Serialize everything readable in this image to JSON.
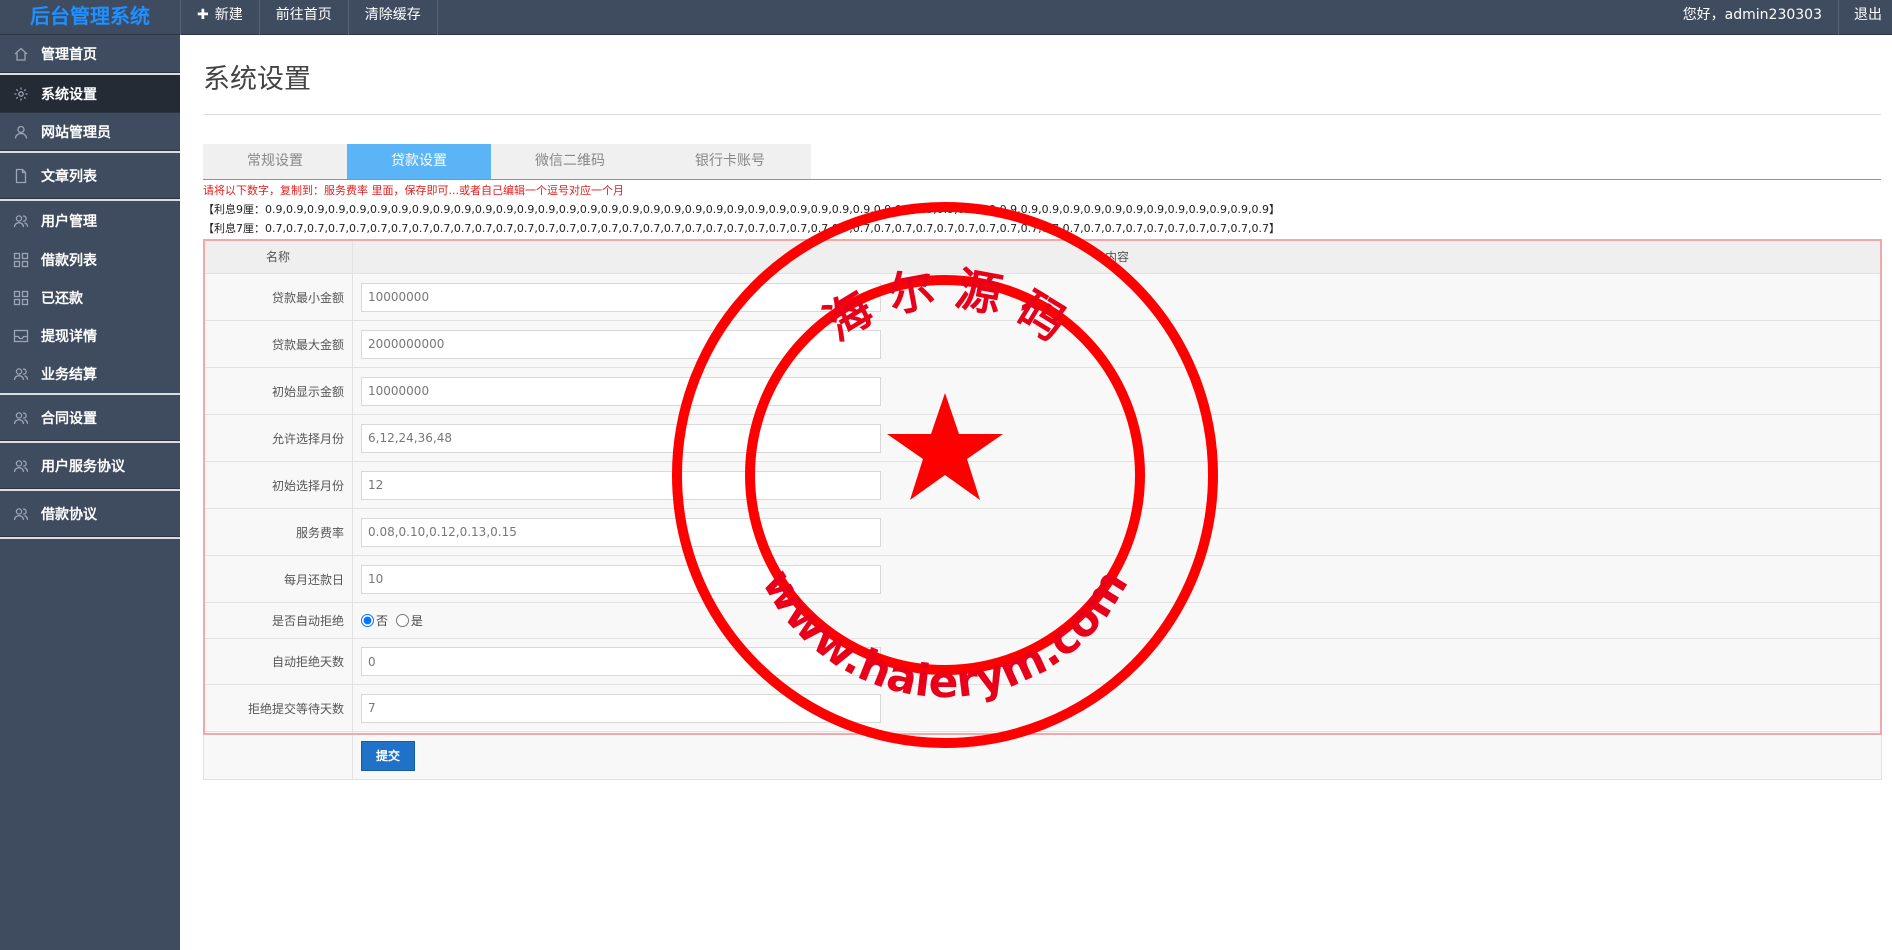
{
  "brand": "后台管理系统",
  "topnav": {
    "new_label": "新建",
    "home_label": "前往首页",
    "clear_cache_label": "清除缓存"
  },
  "topright": {
    "greeting": "您好，admin230303",
    "logout": "退出"
  },
  "sidebar": {
    "items": [
      {
        "label": "管理首页",
        "icon": "home-icon"
      },
      {
        "label": "系统设置",
        "icon": "gear-icon"
      },
      {
        "label": "网站管理员",
        "icon": "user-icon"
      },
      {
        "label": "文章列表",
        "icon": "document-icon"
      },
      {
        "label": "用户管理",
        "icon": "users-icon"
      },
      {
        "label": "借款列表",
        "icon": "grid-icon"
      },
      {
        "label": "已还款",
        "icon": "grid-icon"
      },
      {
        "label": "提现详情",
        "icon": "inbox-icon"
      },
      {
        "label": "业务结算",
        "icon": "users-icon"
      },
      {
        "label": "合同设置",
        "icon": "users-icon"
      },
      {
        "label": "用户服务协议",
        "icon": "users-icon"
      },
      {
        "label": "借款协议",
        "icon": "users-icon"
      }
    ]
  },
  "page_title": "系统设置",
  "tabs": [
    {
      "label": "常规设置",
      "active": false
    },
    {
      "label": "贷款设置",
      "active": true
    },
    {
      "label": "微信二维码",
      "active": false
    },
    {
      "label": "银行卡账号",
      "active": false
    }
  ],
  "notice": {
    "instruction": "请将以下数字，复制到：服务费率 里面，保存即可...或者自己编辑一个逗号对应一个月",
    "line_9": "【利息9厘：0.9,0.9,0.9,0.9,0.9,0.9,0.9,0.9,0.9,0.9,0.9,0.9,0.9,0.9,0.9,0.9,0.9,0.9,0.9,0.9,0.9,0.9,0.9,0.9,0.9,0.9,0.9,0.9,0.9,0.9,0.9,0.9,0.9,0.9,0.9,0.9,0.9,0.9,0.9,0.9,0.9,0.9,0.9,0.9,0.9,0.9,0.9,0.9】",
    "line_7": "【利息7厘：0.7,0.7,0.7,0.7,0.7,0.7,0.7,0.7,0.7,0.7,0.7,0.7,0.7,0.7,0.7,0.7,0.7,0.7,0.7,0.7,0.7,0.7,0.7,0.7,0.7,0.7,0.7,0.7,0.7,0.7,0.7,0.7,0.7,0.7,0.7,0.7,0.7,0.7,0.7,0.7,0.7,0.7,0.7,0.7,0.7,0.7,0.7,0.7】"
  },
  "table": {
    "col_name": "名称",
    "col_content": "内容",
    "rows": [
      {
        "label": "贷款最小金额",
        "value": "10000000"
      },
      {
        "label": "贷款最大金额",
        "value": "2000000000"
      },
      {
        "label": "初始显示金额",
        "value": "10000000"
      },
      {
        "label": "允许选择月份",
        "value": "6,12,24,36,48"
      },
      {
        "label": "初始选择月份",
        "value": "12"
      },
      {
        "label": "服务费率",
        "value": "0.08,0.10,0.12,0.13,0.15"
      },
      {
        "label": "每月还款日",
        "value": "10"
      }
    ],
    "auto_reject": {
      "label": "是否自动拒绝",
      "opt_no": "否",
      "opt_yes": "是",
      "selected": "否"
    },
    "reject_days": {
      "label": "自动拒绝天数",
      "value": "0"
    },
    "wait_days": {
      "label": "拒绝提交等待天数",
      "value": "7"
    },
    "submit_label": "提交"
  },
  "stamp": {
    "top_text": "海 尔 源 码",
    "bottom_text": "www.haierym.com",
    "color": "#ff0000"
  }
}
